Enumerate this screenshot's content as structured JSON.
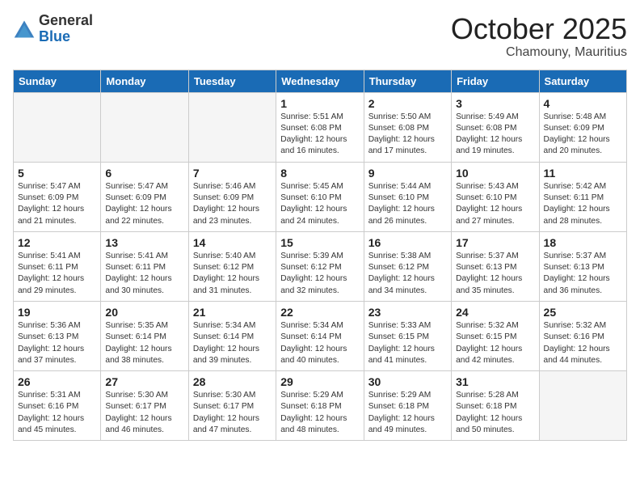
{
  "logo": {
    "general": "General",
    "blue": "Blue"
  },
  "header": {
    "month": "October 2025",
    "location": "Chamouny, Mauritius"
  },
  "weekdays": [
    "Sunday",
    "Monday",
    "Tuesday",
    "Wednesday",
    "Thursday",
    "Friday",
    "Saturday"
  ],
  "weeks": [
    [
      {
        "day": "",
        "sunrise": "",
        "sunset": "",
        "daylight": "",
        "empty": true
      },
      {
        "day": "",
        "sunrise": "",
        "sunset": "",
        "daylight": "",
        "empty": true
      },
      {
        "day": "",
        "sunrise": "",
        "sunset": "",
        "daylight": "",
        "empty": true
      },
      {
        "day": "1",
        "sunrise": "Sunrise: 5:51 AM",
        "sunset": "Sunset: 6:08 PM",
        "daylight": "Daylight: 12 hours and 16 minutes."
      },
      {
        "day": "2",
        "sunrise": "Sunrise: 5:50 AM",
        "sunset": "Sunset: 6:08 PM",
        "daylight": "Daylight: 12 hours and 17 minutes."
      },
      {
        "day": "3",
        "sunrise": "Sunrise: 5:49 AM",
        "sunset": "Sunset: 6:08 PM",
        "daylight": "Daylight: 12 hours and 19 minutes."
      },
      {
        "day": "4",
        "sunrise": "Sunrise: 5:48 AM",
        "sunset": "Sunset: 6:09 PM",
        "daylight": "Daylight: 12 hours and 20 minutes."
      }
    ],
    [
      {
        "day": "5",
        "sunrise": "Sunrise: 5:47 AM",
        "sunset": "Sunset: 6:09 PM",
        "daylight": "Daylight: 12 hours and 21 minutes."
      },
      {
        "day": "6",
        "sunrise": "Sunrise: 5:47 AM",
        "sunset": "Sunset: 6:09 PM",
        "daylight": "Daylight: 12 hours and 22 minutes."
      },
      {
        "day": "7",
        "sunrise": "Sunrise: 5:46 AM",
        "sunset": "Sunset: 6:09 PM",
        "daylight": "Daylight: 12 hours and 23 minutes."
      },
      {
        "day": "8",
        "sunrise": "Sunrise: 5:45 AM",
        "sunset": "Sunset: 6:10 PM",
        "daylight": "Daylight: 12 hours and 24 minutes."
      },
      {
        "day": "9",
        "sunrise": "Sunrise: 5:44 AM",
        "sunset": "Sunset: 6:10 PM",
        "daylight": "Daylight: 12 hours and 26 minutes."
      },
      {
        "day": "10",
        "sunrise": "Sunrise: 5:43 AM",
        "sunset": "Sunset: 6:10 PM",
        "daylight": "Daylight: 12 hours and 27 minutes."
      },
      {
        "day": "11",
        "sunrise": "Sunrise: 5:42 AM",
        "sunset": "Sunset: 6:11 PM",
        "daylight": "Daylight: 12 hours and 28 minutes."
      }
    ],
    [
      {
        "day": "12",
        "sunrise": "Sunrise: 5:41 AM",
        "sunset": "Sunset: 6:11 PM",
        "daylight": "Daylight: 12 hours and 29 minutes."
      },
      {
        "day": "13",
        "sunrise": "Sunrise: 5:41 AM",
        "sunset": "Sunset: 6:11 PM",
        "daylight": "Daylight: 12 hours and 30 minutes."
      },
      {
        "day": "14",
        "sunrise": "Sunrise: 5:40 AM",
        "sunset": "Sunset: 6:12 PM",
        "daylight": "Daylight: 12 hours and 31 minutes."
      },
      {
        "day": "15",
        "sunrise": "Sunrise: 5:39 AM",
        "sunset": "Sunset: 6:12 PM",
        "daylight": "Daylight: 12 hours and 32 minutes."
      },
      {
        "day": "16",
        "sunrise": "Sunrise: 5:38 AM",
        "sunset": "Sunset: 6:12 PM",
        "daylight": "Daylight: 12 hours and 34 minutes."
      },
      {
        "day": "17",
        "sunrise": "Sunrise: 5:37 AM",
        "sunset": "Sunset: 6:13 PM",
        "daylight": "Daylight: 12 hours and 35 minutes."
      },
      {
        "day": "18",
        "sunrise": "Sunrise: 5:37 AM",
        "sunset": "Sunset: 6:13 PM",
        "daylight": "Daylight: 12 hours and 36 minutes."
      }
    ],
    [
      {
        "day": "19",
        "sunrise": "Sunrise: 5:36 AM",
        "sunset": "Sunset: 6:13 PM",
        "daylight": "Daylight: 12 hours and 37 minutes."
      },
      {
        "day": "20",
        "sunrise": "Sunrise: 5:35 AM",
        "sunset": "Sunset: 6:14 PM",
        "daylight": "Daylight: 12 hours and 38 minutes."
      },
      {
        "day": "21",
        "sunrise": "Sunrise: 5:34 AM",
        "sunset": "Sunset: 6:14 PM",
        "daylight": "Daylight: 12 hours and 39 minutes."
      },
      {
        "day": "22",
        "sunrise": "Sunrise: 5:34 AM",
        "sunset": "Sunset: 6:14 PM",
        "daylight": "Daylight: 12 hours and 40 minutes."
      },
      {
        "day": "23",
        "sunrise": "Sunrise: 5:33 AM",
        "sunset": "Sunset: 6:15 PM",
        "daylight": "Daylight: 12 hours and 41 minutes."
      },
      {
        "day": "24",
        "sunrise": "Sunrise: 5:32 AM",
        "sunset": "Sunset: 6:15 PM",
        "daylight": "Daylight: 12 hours and 42 minutes."
      },
      {
        "day": "25",
        "sunrise": "Sunrise: 5:32 AM",
        "sunset": "Sunset: 6:16 PM",
        "daylight": "Daylight: 12 hours and 44 minutes."
      }
    ],
    [
      {
        "day": "26",
        "sunrise": "Sunrise: 5:31 AM",
        "sunset": "Sunset: 6:16 PM",
        "daylight": "Daylight: 12 hours and 45 minutes."
      },
      {
        "day": "27",
        "sunrise": "Sunrise: 5:30 AM",
        "sunset": "Sunset: 6:17 PM",
        "daylight": "Daylight: 12 hours and 46 minutes."
      },
      {
        "day": "28",
        "sunrise": "Sunrise: 5:30 AM",
        "sunset": "Sunset: 6:17 PM",
        "daylight": "Daylight: 12 hours and 47 minutes."
      },
      {
        "day": "29",
        "sunrise": "Sunrise: 5:29 AM",
        "sunset": "Sunset: 6:18 PM",
        "daylight": "Daylight: 12 hours and 48 minutes."
      },
      {
        "day": "30",
        "sunrise": "Sunrise: 5:29 AM",
        "sunset": "Sunset: 6:18 PM",
        "daylight": "Daylight: 12 hours and 49 minutes."
      },
      {
        "day": "31",
        "sunrise": "Sunrise: 5:28 AM",
        "sunset": "Sunset: 6:18 PM",
        "daylight": "Daylight: 12 hours and 50 minutes."
      },
      {
        "day": "",
        "sunrise": "",
        "sunset": "",
        "daylight": "",
        "empty": true
      }
    ]
  ]
}
